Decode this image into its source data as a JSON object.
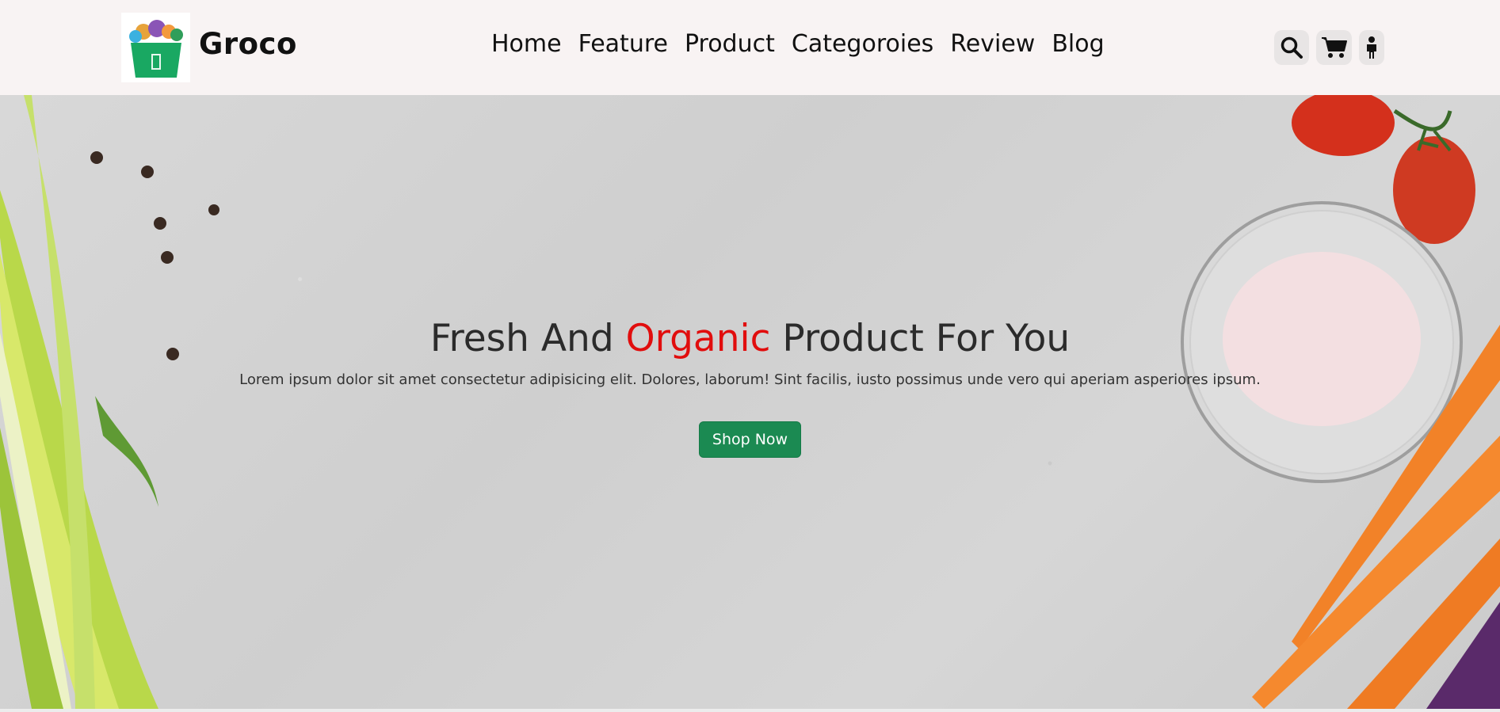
{
  "header": {
    "brand": "Groco",
    "nav": [
      "Home",
      "Feature",
      "Product",
      "Categoroies",
      "Review",
      "Blog"
    ],
    "icons": [
      "search-icon",
      "cart-icon",
      "user-icon"
    ]
  },
  "hero": {
    "title_part1": "Fresh And ",
    "title_accent": "Organic",
    "title_part2": " Product For You",
    "subtitle": "Lorem ipsum dolor sit amet consectetur adipisicing elit. Dolores, laborum! Sint facilis, iusto possimus unde vero qui aperiam asperiores ipsum.",
    "cta": "Shop Now"
  },
  "colors": {
    "nav_bg": "#f8f3f3",
    "accent": "#e10d0d",
    "button": "#1b8a52"
  }
}
